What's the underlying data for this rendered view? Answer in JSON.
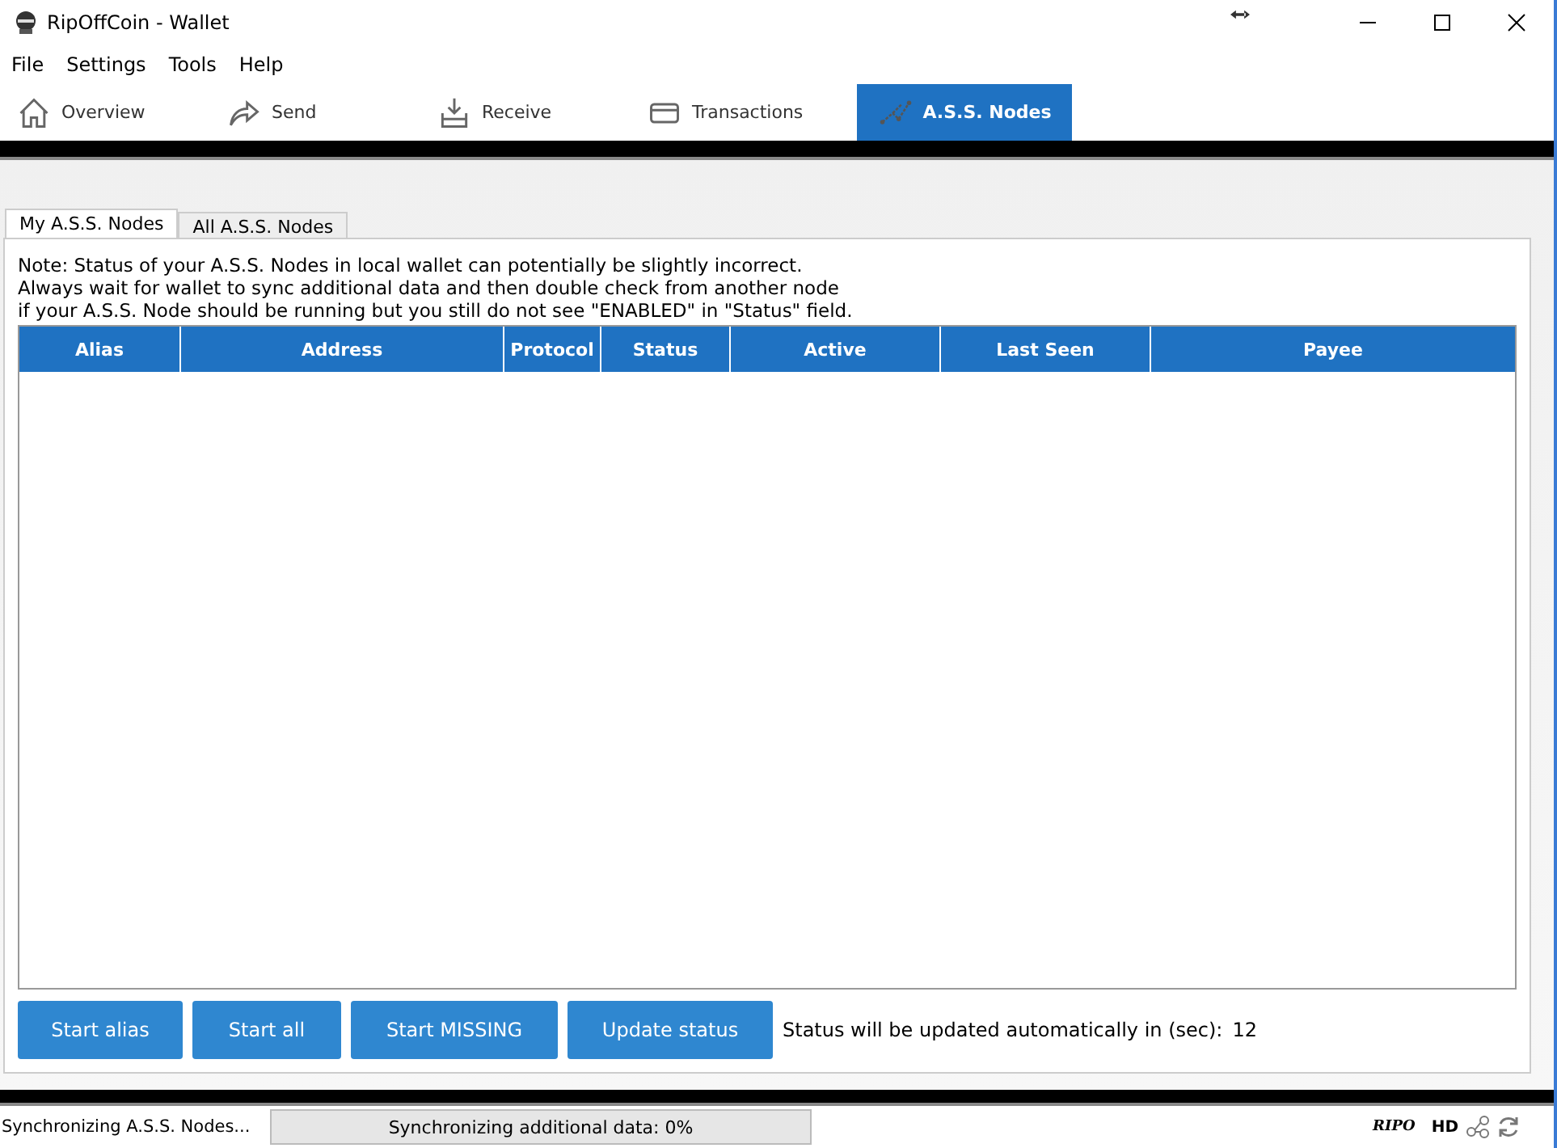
{
  "window": {
    "title": "RipOffCoin - Wallet"
  },
  "menu": [
    "File",
    "Settings",
    "Tools",
    "Help"
  ],
  "tabs": [
    {
      "label": "Overview",
      "selected": false
    },
    {
      "label": "Send",
      "selected": false
    },
    {
      "label": "Receive",
      "selected": false
    },
    {
      "label": "Transactions",
      "selected": false
    },
    {
      "label": "A.S.S. Nodes",
      "selected": true
    }
  ],
  "subtabs": [
    {
      "label": "My A.S.S. Nodes",
      "selected": true
    },
    {
      "label": "All A.S.S. Nodes",
      "selected": false
    }
  ],
  "note": [
    "Note: Status of your A.S.S. Nodes in local wallet can potentially be slightly incorrect.",
    "Always wait for wallet to sync additional data and then double check from another node",
    "if your A.S.S. Node should be running but you still do not see \"ENABLED\" in \"Status\" field."
  ],
  "table": {
    "columns": [
      "Alias",
      "Address",
      "Protocol",
      "Status",
      "Active",
      "Last Seen",
      "Payee"
    ]
  },
  "buttons": [
    "Start alias",
    "Start all",
    "Start MISSING",
    "Update status"
  ],
  "update_label": "Status will be updated automatically in (sec):",
  "update_seconds": "12",
  "status_bar": {
    "message": "Synchronizing A.S.S. Nodes...",
    "progress": {
      "label": "Synchronizing additional data: 0%",
      "level": 0
    },
    "unit": "RIPO",
    "hd": "HD"
  }
}
